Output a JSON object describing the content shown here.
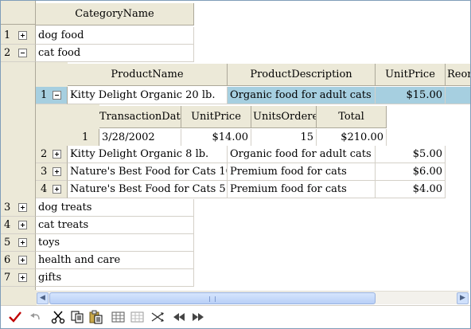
{
  "master": {
    "header": "CategoryName",
    "rows_top": [
      {
        "num": "1",
        "name": "dog food",
        "expanded": false
      },
      {
        "num": "2",
        "name": "cat food",
        "expanded": true
      }
    ],
    "rows_bottom": [
      {
        "num": "3",
        "name": "dog treats"
      },
      {
        "num": "4",
        "name": "cat treats"
      },
      {
        "num": "5",
        "name": "toys"
      },
      {
        "num": "6",
        "name": "health and care"
      },
      {
        "num": "7",
        "name": "gifts"
      }
    ]
  },
  "products": {
    "headers": [
      "ProductName",
      "ProductDescription",
      "UnitPrice",
      "Reor"
    ],
    "rows": [
      {
        "num": "1",
        "name": "Kitty Delight Organic 20 lb.",
        "description": "Organic food for adult cats",
        "price": "$15.00"
      },
      {
        "num": "2",
        "name": "Kitty Delight Organic 8 lb.",
        "description": "Organic food for adult cats",
        "price": "$5.00"
      },
      {
        "num": "3",
        "name": "Nature's Best Food for Cats 10",
        "description": "Premium food for cats",
        "price": "$6.00"
      },
      {
        "num": "4",
        "name": "Nature's Best Food for Cats 5",
        "description": "Premium food for cats",
        "price": "$4.00"
      }
    ]
  },
  "transactions": {
    "headers": [
      "TransactionDate",
      "UnitPrice",
      "UnitsOrdered",
      "Total"
    ],
    "rows": [
      {
        "num": "1",
        "date": "3/28/2002",
        "price": "$14.00",
        "units": "15",
        "total": "$210.00"
      }
    ]
  },
  "scrollbar": {
    "left_arrow": "◀",
    "right_arrow": "▶"
  },
  "toolbar": {
    "icons": [
      "check-icon",
      "undo-icon",
      "cut-icon",
      "copy-icon",
      "paste-icon",
      "grid-icon",
      "grid-alt-icon",
      "shuffle-icon",
      "rewind-icon",
      "fast-forward-icon"
    ],
    "accent": "#c00000"
  }
}
